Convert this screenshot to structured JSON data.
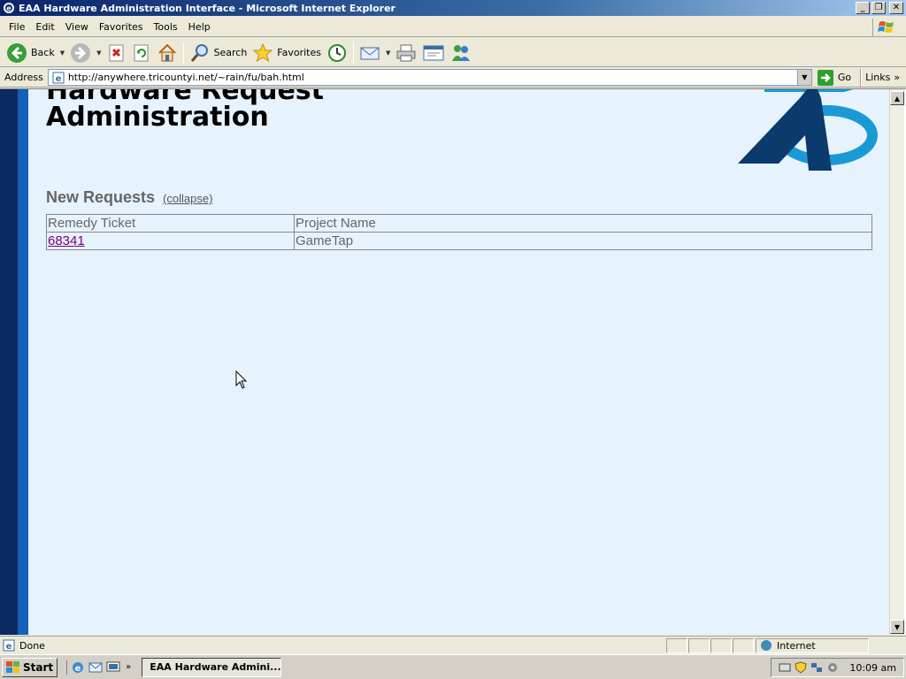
{
  "window": {
    "title": "EAA Hardware Administration Interface - Microsoft Internet Explorer",
    "buttons": {
      "minimize": "_",
      "maximize": "❐",
      "close": "✕"
    }
  },
  "menu": [
    {
      "label": "File"
    },
    {
      "label": "Edit"
    },
    {
      "label": "View"
    },
    {
      "label": "Favorites"
    },
    {
      "label": "Tools"
    },
    {
      "label": "Help"
    }
  ],
  "toolbar": {
    "back": "Back",
    "search": "Search",
    "favorites": "Favorites"
  },
  "address": {
    "label": "Address",
    "url": "http://anywhere.tricountyi.net/~rain/fu/bah.html",
    "go": "Go",
    "links": "Links",
    "links_chevron": "»"
  },
  "page": {
    "heading_clipped": "Hardware Request",
    "heading": "Administration",
    "section_title": "New Requests",
    "collapse_link": "(collapse)",
    "table": {
      "headers": [
        "Remedy Ticket",
        "Project Name"
      ],
      "rows": [
        {
          "ticket": "68341",
          "project": "GameTap"
        }
      ]
    },
    "colors": {
      "background": "#e6f2fc",
      "stripe_dark": "#0b2a63",
      "stripe_light": "#1560b8",
      "link_visited": "#800080"
    }
  },
  "status": {
    "text": "Done",
    "zone": "Internet"
  },
  "taskbar": {
    "start": "Start",
    "quick_launch_chevron": "»",
    "task": "EAA Hardware Admini...",
    "clock": "10:09 am"
  }
}
